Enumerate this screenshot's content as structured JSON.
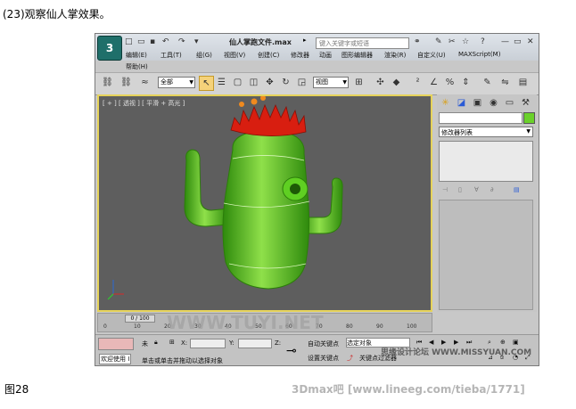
{
  "caption": "(23)观察仙人掌效果。",
  "figure_label": "图28",
  "footer": "3Dmax吧  [www.lineeg.com/tieba/1771]",
  "app": {
    "title": "仙人掌跑文件.max",
    "search_placeholder": "键入关键字或短语",
    "menu_row1": [
      "编辑(E)",
      "工具(T)",
      "组(G)",
      "视图(V)",
      "创建(C)",
      "修改器",
      "动画",
      "图形编辑器",
      "渲染(R)",
      "自定义(U)",
      "MAXScript(M)"
    ],
    "menu_row2": [
      "帮助(H)"
    ]
  },
  "toolbar": {
    "selection_filter": "全部",
    "reference_coord": "视图"
  },
  "viewport": {
    "label": "[ + ] [ 透视 ] [ 平滑 + 高光 ]"
  },
  "command_panel": {
    "modifier_list": "修改器列表"
  },
  "timeline": {
    "frame_counter": "0 / 100",
    "ticks": [
      "0",
      "10",
      "20",
      "30",
      "40",
      "50",
      "60",
      "70",
      "80",
      "90",
      "100"
    ]
  },
  "status": {
    "welcome": "欢迎使用 I",
    "selection": "未",
    "x_label": "X:",
    "y_label": "Y:",
    "z_label": "Z:",
    "prompt": "单击或单击并拖动以选择对象",
    "auto_key": "自动关键点",
    "set_key": "设置关键点",
    "selected_objects": "选定对象",
    "key_filters": "关键点过滤器"
  },
  "watermarks": {
    "tuyi": "WWW.TUYI.NET",
    "missyuan": "思缘设计论坛 WWW.MISSYUAN.COM"
  },
  "colors": {
    "cactus": "#4fc21a",
    "flower": "#d81e10",
    "viewport_bg": "#5e5e5e",
    "viewport_border": "#e6d35a"
  }
}
